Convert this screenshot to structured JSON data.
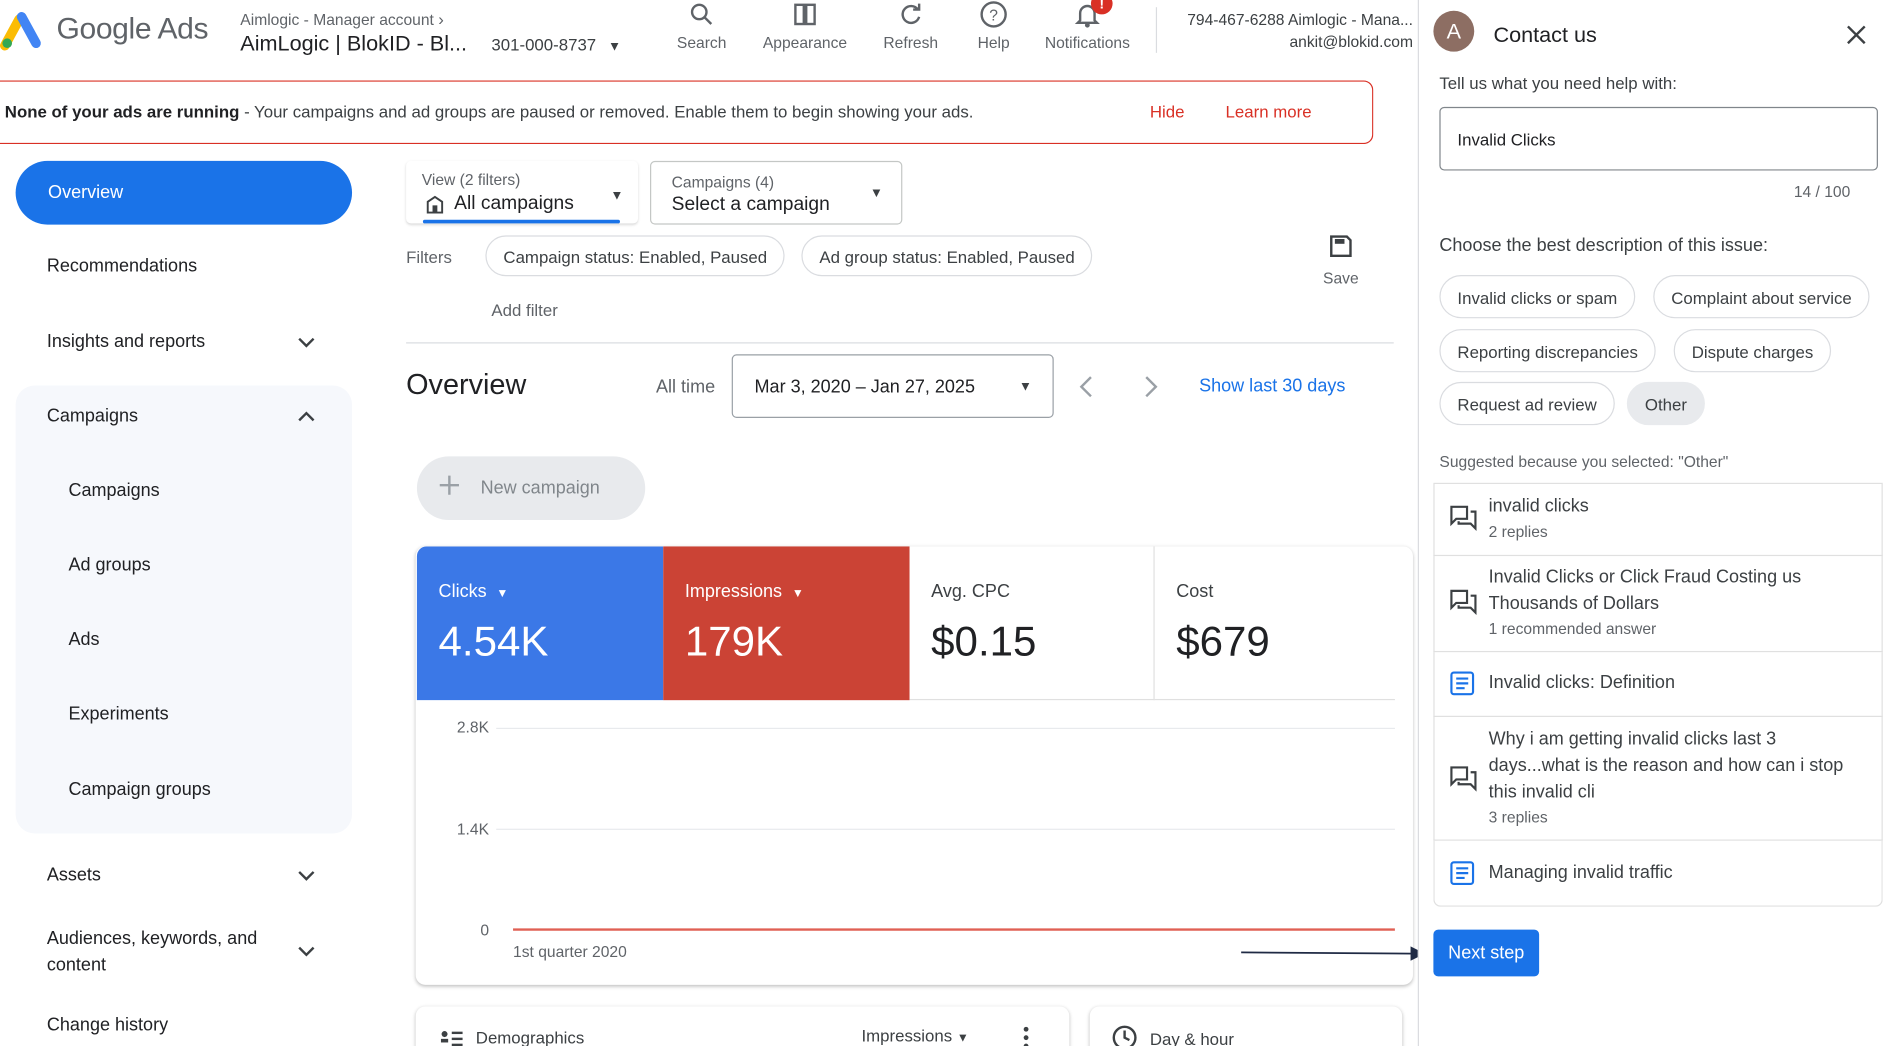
{
  "header": {
    "logo_text": "Google Ads",
    "account_small": "Aimlogic - Manager account",
    "account_name": "AimLogic | BlokID - Bl...",
    "account_id": "301-000-8737",
    "toolbar": [
      {
        "label": "Search",
        "icon": "search-icon"
      },
      {
        "label": "Appearance",
        "icon": "appearance-icon"
      },
      {
        "label": "Refresh",
        "icon": "refresh-icon"
      },
      {
        "label": "Help",
        "icon": "help-icon"
      },
      {
        "label": "Notifications",
        "icon": "bell-icon",
        "badge": "!"
      }
    ],
    "user_line1": "794-467-6288 Aimlogic - Mana...",
    "user_line2": "ankit@blokid.com"
  },
  "banner": {
    "bold": "None of your ads are running",
    "text": " - Your campaigns and ad groups are paused or removed. Enable them to begin showing your ads.",
    "hide": "Hide",
    "learn_more": "Learn more"
  },
  "nav": {
    "overview": "Overview",
    "recommendations": "Recommendations",
    "insights": "Insights and reports",
    "campaigns_section": "Campaigns",
    "sub": [
      "Campaigns",
      "Ad groups",
      "Ads",
      "Experiments",
      "Campaign groups"
    ],
    "assets": "Assets",
    "audiences": "Audiences, keywords, and content",
    "change_history": "Change history"
  },
  "filters": {
    "view_label": "View (2 filters)",
    "view_value": "All campaigns",
    "campaigns_label": "Campaigns (4)",
    "campaigns_value": "Select a campaign",
    "filters_label": "Filters",
    "chips": [
      "Campaign status: Enabled, Paused",
      "Ad group status: Enabled, Paused"
    ],
    "add_filter": "Add filter",
    "save": "Save"
  },
  "overview": {
    "title": "Overview",
    "all_time": "All time",
    "date_range": "Mar 3, 2020 – Jan 27, 2025",
    "show_last": "Show last 30 days",
    "new_campaign": "New campaign"
  },
  "metrics": [
    {
      "label": "Clicks",
      "value": "4.54K",
      "color": "#3b78e7"
    },
    {
      "label": "Impressions",
      "value": "179K",
      "color": "#cb4335"
    },
    {
      "label": "Avg. CPC",
      "value": "$0.15"
    },
    {
      "label": "Cost",
      "value": "$679"
    }
  ],
  "chart_data": {
    "type": "line",
    "yticks": [
      "2.8K",
      "1.4K",
      "0"
    ],
    "ylim": [
      0,
      2800
    ],
    "x": [
      "1st quarter 2020"
    ],
    "series": [
      {
        "values": [
          0,
          0
        ],
        "color": "#e06055"
      }
    ]
  },
  "bottom_cards": {
    "demographics": "Demographics",
    "impressions": "Impressions",
    "day_hour": "Day & hour"
  },
  "panel": {
    "avatar": "A",
    "title": "Contact us",
    "prompt": "Tell us what you need help with:",
    "input_value": "Invalid Clicks",
    "counter": "14 / 100",
    "choose": "Choose the best description of this issue:",
    "chips": [
      "Invalid clicks or spam",
      "Complaint about service",
      "Reporting discrepancies",
      "Dispute charges",
      "Request ad review",
      "Other"
    ],
    "suggested": "Suggested because you selected: \"Other\"",
    "results": [
      {
        "title": "invalid clicks",
        "sub": "2 replies",
        "icon": "forum-icon"
      },
      {
        "title": "Invalid Clicks or Click Fraud Costing us Thousands of Dollars",
        "sub": "1 recommended answer",
        "icon": "forum-icon"
      },
      {
        "title": "Invalid clicks: Definition",
        "sub": "",
        "icon": "article-icon"
      },
      {
        "title": "Why i am getting invalid clicks last 3 days...what is the reason and how can i stop this invalid cli",
        "sub": "3 replies",
        "icon": "forum-icon"
      },
      {
        "title": "Managing invalid traffic",
        "sub": "",
        "icon": "article-icon"
      }
    ],
    "next_step": "Next step"
  }
}
